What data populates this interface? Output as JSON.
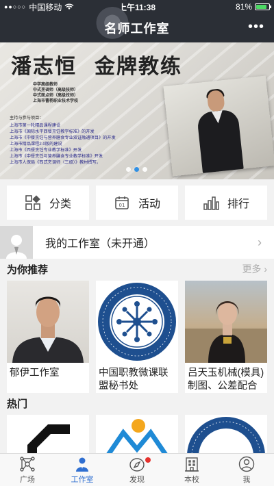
{
  "status": {
    "carrier": "中国移动",
    "time": "上午11:38",
    "battery": "81%",
    "battery_level": 0.81
  },
  "nav": {
    "title": "名师工作室",
    "more": "•••"
  },
  "banner": {
    "name": "潘志恒",
    "honor": "金牌教练",
    "titles": [
      "中学高级教师",
      "中式烹调师（高级技师）",
      "中式面点师（高级技师）",
      "上海市曹杨职业技术学校"
    ],
    "body_head": "主持与参与项目：",
    "body_lines": [
      "上海市第一轮精品课程建设",
      "上海市《国际水平西餐烹饪教学标准》的开发",
      "上海市《中餐烹饪与营养膳食专业双证融通项目》的开发",
      "上海市精品课程2.0版的建设",
      "上海市《西餐烹饪专业教学标准》开发",
      "上海市《中餐烹饪与营养膳食专业教学标准》开发",
      "上海市人保局《西式烹调师（三级）》教材撰写。"
    ],
    "slide_count": 3,
    "active_slide": 1
  },
  "quick": {
    "category": "分类",
    "activity": "活动",
    "ranking": "排行"
  },
  "my_studio": {
    "label": "我的工作室（未开通）",
    "chevron": "›"
  },
  "recommend": {
    "title": "为你推荐",
    "more": "更多 ›",
    "cards": [
      {
        "caption": "郁伊工作室"
      },
      {
        "caption": "中国职教微课联盟秘书处"
      },
      {
        "caption": "吕天玉机械(模具)制图、公差配合与测..."
      }
    ]
  },
  "hot": {
    "title": "热门"
  },
  "tabs": [
    {
      "label": "广场",
      "icon": "network-icon"
    },
    {
      "label": "工作室",
      "icon": "person-icon"
    },
    {
      "label": "发现",
      "icon": "compass-icon"
    },
    {
      "label": "本校",
      "icon": "building-icon"
    },
    {
      "label": "我",
      "icon": "user-circle-icon"
    }
  ],
  "colors": {
    "header_bg": "#2b2f36",
    "accent": "#2f6fd1",
    "badge_red": "#e5322d",
    "seal_blue": "#1e4f8f"
  }
}
